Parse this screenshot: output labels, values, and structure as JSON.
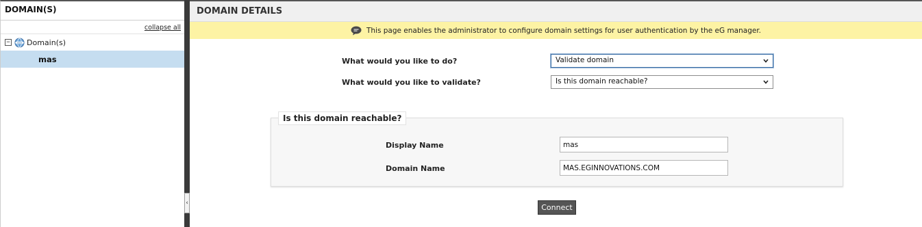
{
  "sidebar": {
    "title": "DOMAIN(S)",
    "collapse_all": "collapse all",
    "tree_root": {
      "toggle": "−",
      "label": "Domain(s)",
      "icon": "globe-icon"
    },
    "tree_child": {
      "label": "mas"
    }
  },
  "splitter": {
    "handle": "‹"
  },
  "main": {
    "title": "DOMAIN DETAILS",
    "info_text": "This page enables the administrator to configure domain settings for user authentication by the eG manager.",
    "q1_label": "What would you like to do?",
    "q1_value": "Validate domain",
    "q2_label": "What would you like to validate?",
    "q2_value": "Is this domain reachable?",
    "section_title": "Is this domain reachable?",
    "display_name_label": "Display Name",
    "display_name_value": "mas",
    "domain_name_label": "Domain Name",
    "domain_name_value": "MAS.EGINNOVATIONS.COM",
    "connect_label": "Connect"
  },
  "colors": {
    "info_bar": "#fdf3a4",
    "selected_tree_item": "#c5ddf0",
    "splitter": "#3a3a3a",
    "button": "#555555"
  }
}
